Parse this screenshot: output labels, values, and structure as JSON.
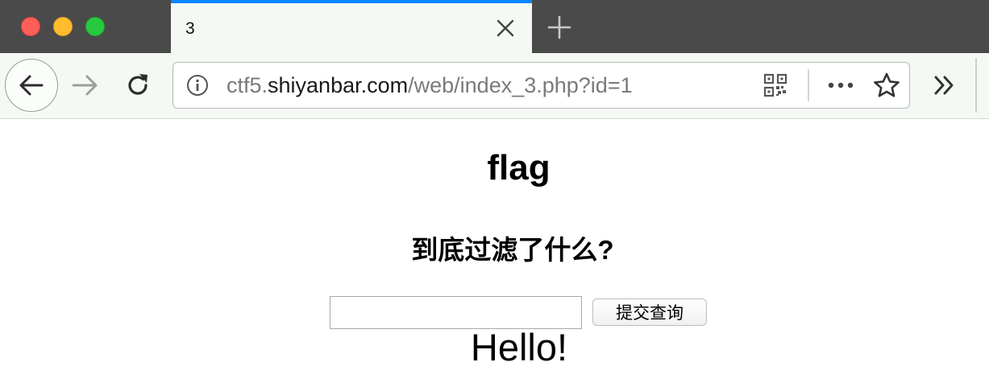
{
  "window": {
    "buttons": [
      "close",
      "minimize",
      "zoom"
    ]
  },
  "tab": {
    "title": "3",
    "close_icon": "close-icon",
    "new_tab_icon": "plus-icon",
    "accent_color": "#0a84ff"
  },
  "toolbar": {
    "back_icon": "arrow-left-icon",
    "forward_icon": "arrow-right-icon",
    "reload_icon": "reload-icon",
    "overflow_icon": "double-chevron-right-icon"
  },
  "urlbar": {
    "info_icon": "info-icon",
    "url_prefix": "ctf5.",
    "url_domain": "shiyanbar.com",
    "url_path": "/web/index_3.php?id=1",
    "qr_icon": "qr-code-icon",
    "more_icon": "more-dots-icon",
    "bookmark_icon": "star-icon"
  },
  "page": {
    "heading": "flag",
    "subheading": "到底过滤了什么?",
    "input_value": "",
    "submit_label": "提交查询",
    "result": "Hello!"
  }
}
